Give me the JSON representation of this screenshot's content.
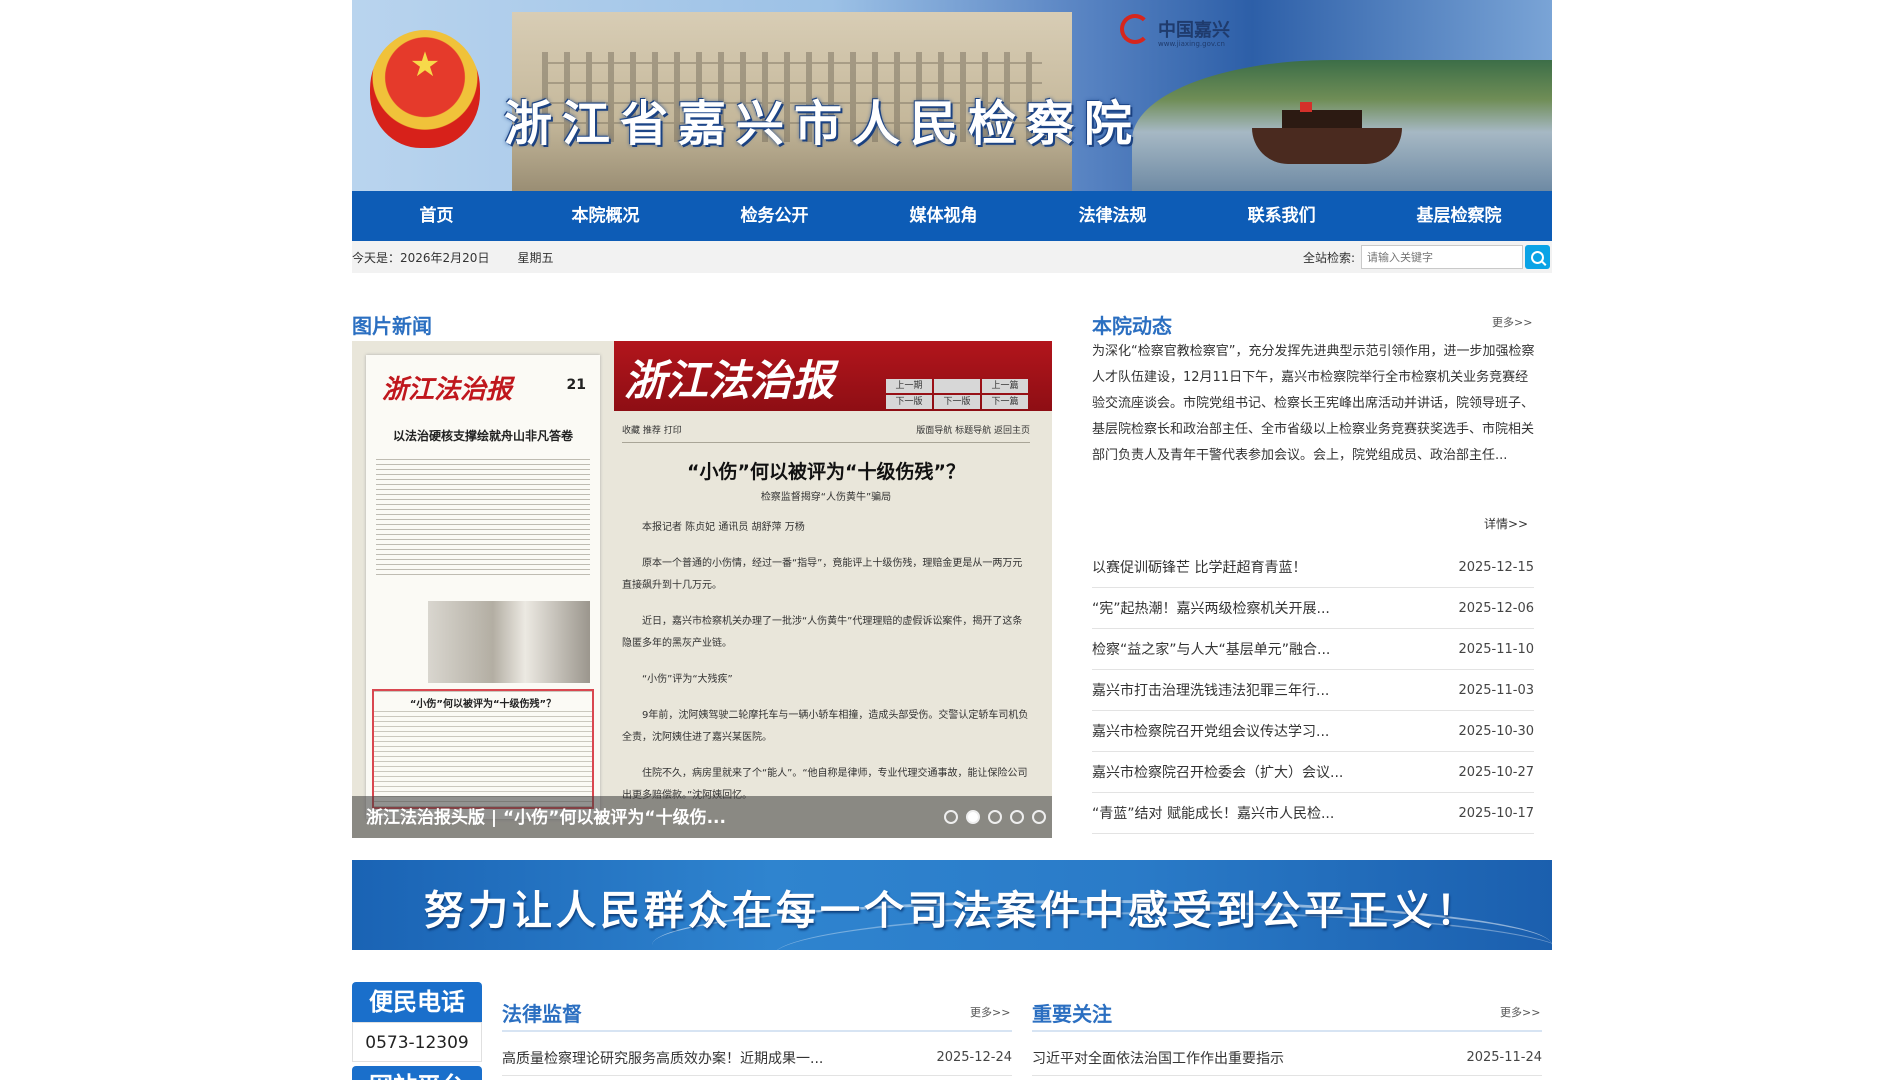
{
  "header": {
    "site_title": "浙江省嘉兴市人民检察院",
    "partner_logo": "中国嘉兴",
    "partner_url": "www.jiaxing.gov.cn",
    "emblem_icon": "national-emblem-icon"
  },
  "nav": {
    "items": [
      "首页",
      "本院概况",
      "检务公开",
      "媒体视角",
      "法律法规",
      "联系我们",
      "基层检察院"
    ]
  },
  "infobar": {
    "date": "今天是：2026年2月20日",
    "weekday": "星期五",
    "search_label": "全站检索:",
    "search_placeholder": "请输入关键字",
    "search_icon": "search-icon"
  },
  "photo_news": {
    "title": "图片新闻",
    "caption": "浙江法治报头版 | “小伤”何以被评为“十级伤...",
    "slide_count": 5,
    "active_slide": 1,
    "paper": {
      "masthead": "浙江法治报",
      "page_number": "21",
      "front_headline": "以法治硬核支撑绘就舟山非凡答卷",
      "box_title": "“小伤”何以被评为“十级伤残”？",
      "article_title": "“小伤”何以被评为“十级伤残”？",
      "article_byline": "检察监督揭穿“人伤黄牛”骗局",
      "tools": "收藏  推荐  打印",
      "pager": [
        "上一期",
        "",
        "上一篇",
        "下一版",
        "下一版",
        "下一篇"
      ],
      "nav_links": "版面导航  标题导航  返回主页",
      "paragraphs": [
        "本报记者 陈贞妃 通讯员 胡舒萍 万杨",
        "原本一个普通的小伤情，经过一番“指导”，竟能评上十级伤残，理赔金更是从一两万元直接飙升到十几万元。",
        "近日，嘉兴市检察机关办理了一批涉“人伤黄牛”代理理赔的虚假诉讼案件，揭开了这条隐匿多年的黑灰产业链。",
        "“小伤”评为“大残疾”",
        "9年前，沈阿姨驾驶二轮摩托车与一辆小轿车相撞，造成头部受伤。交警认定轿车司机负全责，沈阿姨住进了嘉兴某医院。",
        "住院不久，病房里就来了个“能人”。“他自称是律师，专业代理交通事故，能让保险公司出更多赔偿款。”沈阿姨回忆。"
      ]
    }
  },
  "dongtai": {
    "title": "本院动态",
    "more": "更多>>",
    "summary": "为深化“检察官教检察官”，充分发挥先进典型示范引领作用，进一步加强检察人才队伍建设，12月11日下午，嘉兴市检察院举行全市检察机关业务竞赛经验交流座谈会。市院党组书记、检察长王宪峰出席活动并讲话，院领导班子、基层院检察长和政治部主任、全市省级以上检察业务竞赛获奖选手、市院相关部门负责人及青年干警代表参加会议。会上，院党组成员、政治部主任...",
    "detail": "详情>>",
    "items": [
      {
        "title": "以赛促训砺锋芒 比学赶超育青蓝！",
        "date": "2025-12-15"
      },
      {
        "title": "“宪”起热潮！嘉兴两级检察机关开展...",
        "date": "2025-12-06"
      },
      {
        "title": "检察“益之家”与人大“基层单元”融合...",
        "date": "2025-11-10"
      },
      {
        "title": "嘉兴市打击治理洗钱违法犯罪三年行...",
        "date": "2025-11-03"
      },
      {
        "title": "嘉兴市检察院召开党组会议传达学习...",
        "date": "2025-10-30"
      },
      {
        "title": "嘉兴市检察院召开检委会（扩大）会议...",
        "date": "2025-10-27"
      },
      {
        "title": "“青蓝”结对 赋能成长！嘉兴市人民检...",
        "date": "2025-10-17"
      }
    ]
  },
  "slogan": "努力让人民群众在每一个司法案件中感受到公平正义！",
  "hotline": {
    "title": "便民电话",
    "number": "0573-12309",
    "next_title": "网站平台"
  },
  "legal_supervision": {
    "title": "法律监督",
    "more": "更多>>",
    "items": [
      {
        "title": "高质量检察理论研究服务高质效办案！近期成果一...",
        "date": "2025-12-24"
      }
    ]
  },
  "key_focus": {
    "title": "重要关注",
    "more": "更多>>",
    "items": [
      {
        "title": "习近平对全面依法治国工作作出重要指示",
        "date": "2025-11-24"
      }
    ]
  },
  "colors": {
    "nav_blue": "#0d5cb6",
    "title_blue": "#2b6fc1",
    "search_btn": "#0aa3e6"
  }
}
